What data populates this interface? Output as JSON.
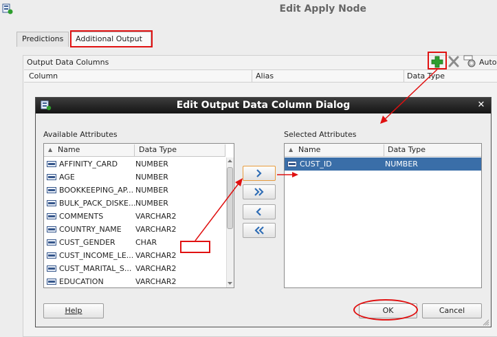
{
  "window": {
    "title": "Edit Apply Node"
  },
  "tabs": [
    {
      "label": "Predictions"
    },
    {
      "label": "Additional Output"
    }
  ],
  "output_panel": {
    "label": "Output Data Columns",
    "columns": [
      "Column",
      "Alias",
      "Data Type"
    ],
    "auto_label": "Auto"
  },
  "dialog": {
    "title": "Edit Output Data Column Dialog",
    "available": {
      "label": "Available Attributes",
      "columns": [
        "Name",
        "Data Type"
      ],
      "rows": [
        {
          "name": "AFFINITY_CARD",
          "type": "NUMBER"
        },
        {
          "name": "AGE",
          "type": "NUMBER"
        },
        {
          "name": "BOOKKEEPING_AP...",
          "type": "NUMBER"
        },
        {
          "name": "BULK_PACK_DISKE...",
          "type": "NUMBER"
        },
        {
          "name": "COMMENTS",
          "type": "VARCHAR2"
        },
        {
          "name": "COUNTRY_NAME",
          "type": "VARCHAR2"
        },
        {
          "name": "CUST_GENDER",
          "type": "CHAR"
        },
        {
          "name": "CUST_INCOME_LE...",
          "type": "VARCHAR2"
        },
        {
          "name": "CUST_MARITAL_S...",
          "type": "VARCHAR2"
        },
        {
          "name": "EDUCATION",
          "type": "VARCHAR2"
        }
      ]
    },
    "selected": {
      "label": "Selected Attributes",
      "columns": [
        "Name",
        "Data Type"
      ],
      "rows": [
        {
          "name": "CUST_ID",
          "type": "NUMBER"
        }
      ]
    },
    "buttons": {
      "help": "Help",
      "ok": "OK",
      "cancel": "Cancel"
    }
  },
  "colors": {
    "annotation": "#e01010",
    "selection": "#3a6ea8",
    "add_icon": "#2e9e2e",
    "move_arrow": "#2f6db5"
  },
  "icons": {
    "add": "plus-icon",
    "delete": "x-icon",
    "auto": "gear-icon",
    "attribute_type": "xyz-type-icon",
    "close": "close-icon"
  }
}
